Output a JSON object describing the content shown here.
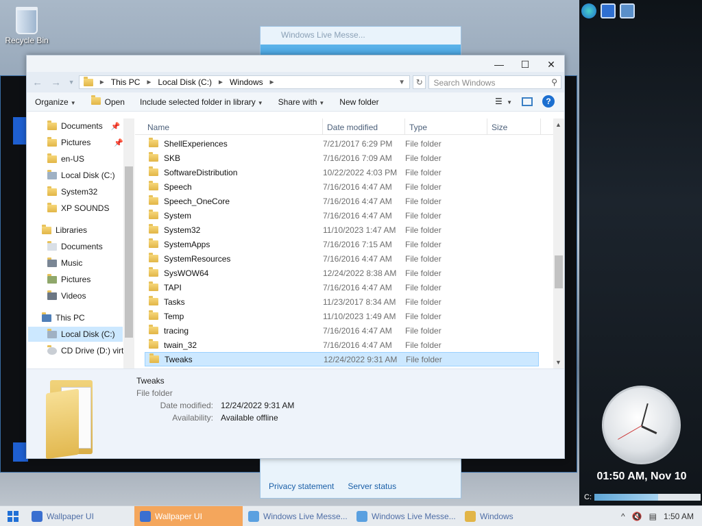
{
  "desktop": {
    "recycle_bin": "Recycle Bin"
  },
  "wlm_window": {
    "title": "Windows Live Messe...",
    "privacy": "Privacy statement",
    "server": "Server status"
  },
  "explorer": {
    "breadcrumbs": [
      "This PC",
      "Local Disk (C:)",
      "Windows"
    ],
    "search_placeholder": "Search Windows",
    "toolbar": {
      "organize": "Organize",
      "open": "Open",
      "include": "Include selected folder in library",
      "share": "Share with",
      "new_folder": "New folder"
    },
    "nav": [
      {
        "label": "Documents",
        "pinned": true
      },
      {
        "label": "Pictures",
        "pinned": true
      },
      {
        "label": "en-US"
      },
      {
        "label": "Local Disk (C:)"
      },
      {
        "label": "System32"
      },
      {
        "label": "XP SOUNDS"
      },
      {
        "label": "Libraries"
      },
      {
        "label": "Documents"
      },
      {
        "label": "Music"
      },
      {
        "label": "Pictures"
      },
      {
        "label": "Videos"
      },
      {
        "label": "This PC"
      },
      {
        "label": "Local Disk (C:)",
        "selected": true
      },
      {
        "label": "CD Drive (D:) virt"
      }
    ],
    "columns": {
      "name": "Name",
      "date": "Date modified",
      "type": "Type",
      "size": "Size"
    },
    "files": [
      {
        "name": "ShellExperiences",
        "date": "7/21/2017 6:29 PM",
        "type": "File folder"
      },
      {
        "name": "SKB",
        "date": "7/16/2016 7:09 AM",
        "type": "File folder"
      },
      {
        "name": "SoftwareDistribution",
        "date": "10/22/2022 4:03 PM",
        "type": "File folder"
      },
      {
        "name": "Speech",
        "date": "7/16/2016 4:47 AM",
        "type": "File folder"
      },
      {
        "name": "Speech_OneCore",
        "date": "7/16/2016 4:47 AM",
        "type": "File folder"
      },
      {
        "name": "System",
        "date": "7/16/2016 4:47 AM",
        "type": "File folder"
      },
      {
        "name": "System32",
        "date": "11/10/2023 1:47 AM",
        "type": "File folder"
      },
      {
        "name": "SystemApps",
        "date": "7/16/2016 7:15 AM",
        "type": "File folder"
      },
      {
        "name": "SystemResources",
        "date": "7/16/2016 4:47 AM",
        "type": "File folder"
      },
      {
        "name": "SysWOW64",
        "date": "12/24/2022 8:38 AM",
        "type": "File folder"
      },
      {
        "name": "TAPI",
        "date": "7/16/2016 4:47 AM",
        "type": "File folder"
      },
      {
        "name": "Tasks",
        "date": "11/23/2017 8:34 AM",
        "type": "File folder"
      },
      {
        "name": "Temp",
        "date": "11/10/2023 1:49 AM",
        "type": "File folder"
      },
      {
        "name": "tracing",
        "date": "7/16/2016 4:47 AM",
        "type": "File folder"
      },
      {
        "name": "twain_32",
        "date": "7/16/2016 4:47 AM",
        "type": "File folder"
      },
      {
        "name": "Tweaks",
        "date": "12/24/2022 9:31 AM",
        "type": "File folder",
        "selected": true
      }
    ],
    "details": {
      "name": "Tweaks",
      "type": "File folder",
      "date_label": "Date modified:",
      "date_value": "12/24/2022 9:31 AM",
      "avail_label": "Availability:",
      "avail_value": "Available offline"
    }
  },
  "gadgets": {
    "clock_text": "01:50 AM, Nov 10",
    "drive_label": "C:"
  },
  "taskbar": {
    "buttons": [
      {
        "label": "Wallpaper UI",
        "active": false,
        "color": "#3a6fd0"
      },
      {
        "label": "Wallpaper UI",
        "active": true,
        "color": "#3a6fd0"
      },
      {
        "label": "Windows Live Messe...",
        "active": false,
        "color": "#5aa0e0"
      },
      {
        "label": "Windows Live Messe...",
        "active": false,
        "color": "#5aa0e0"
      },
      {
        "label": "Windows",
        "active": false,
        "color": "#e2b547"
      }
    ],
    "time": "1:50 AM"
  },
  "colors": {
    "accent": "#1c6fd0",
    "selection": "#cce8ff",
    "taskbar_active": "#f4a65c"
  }
}
